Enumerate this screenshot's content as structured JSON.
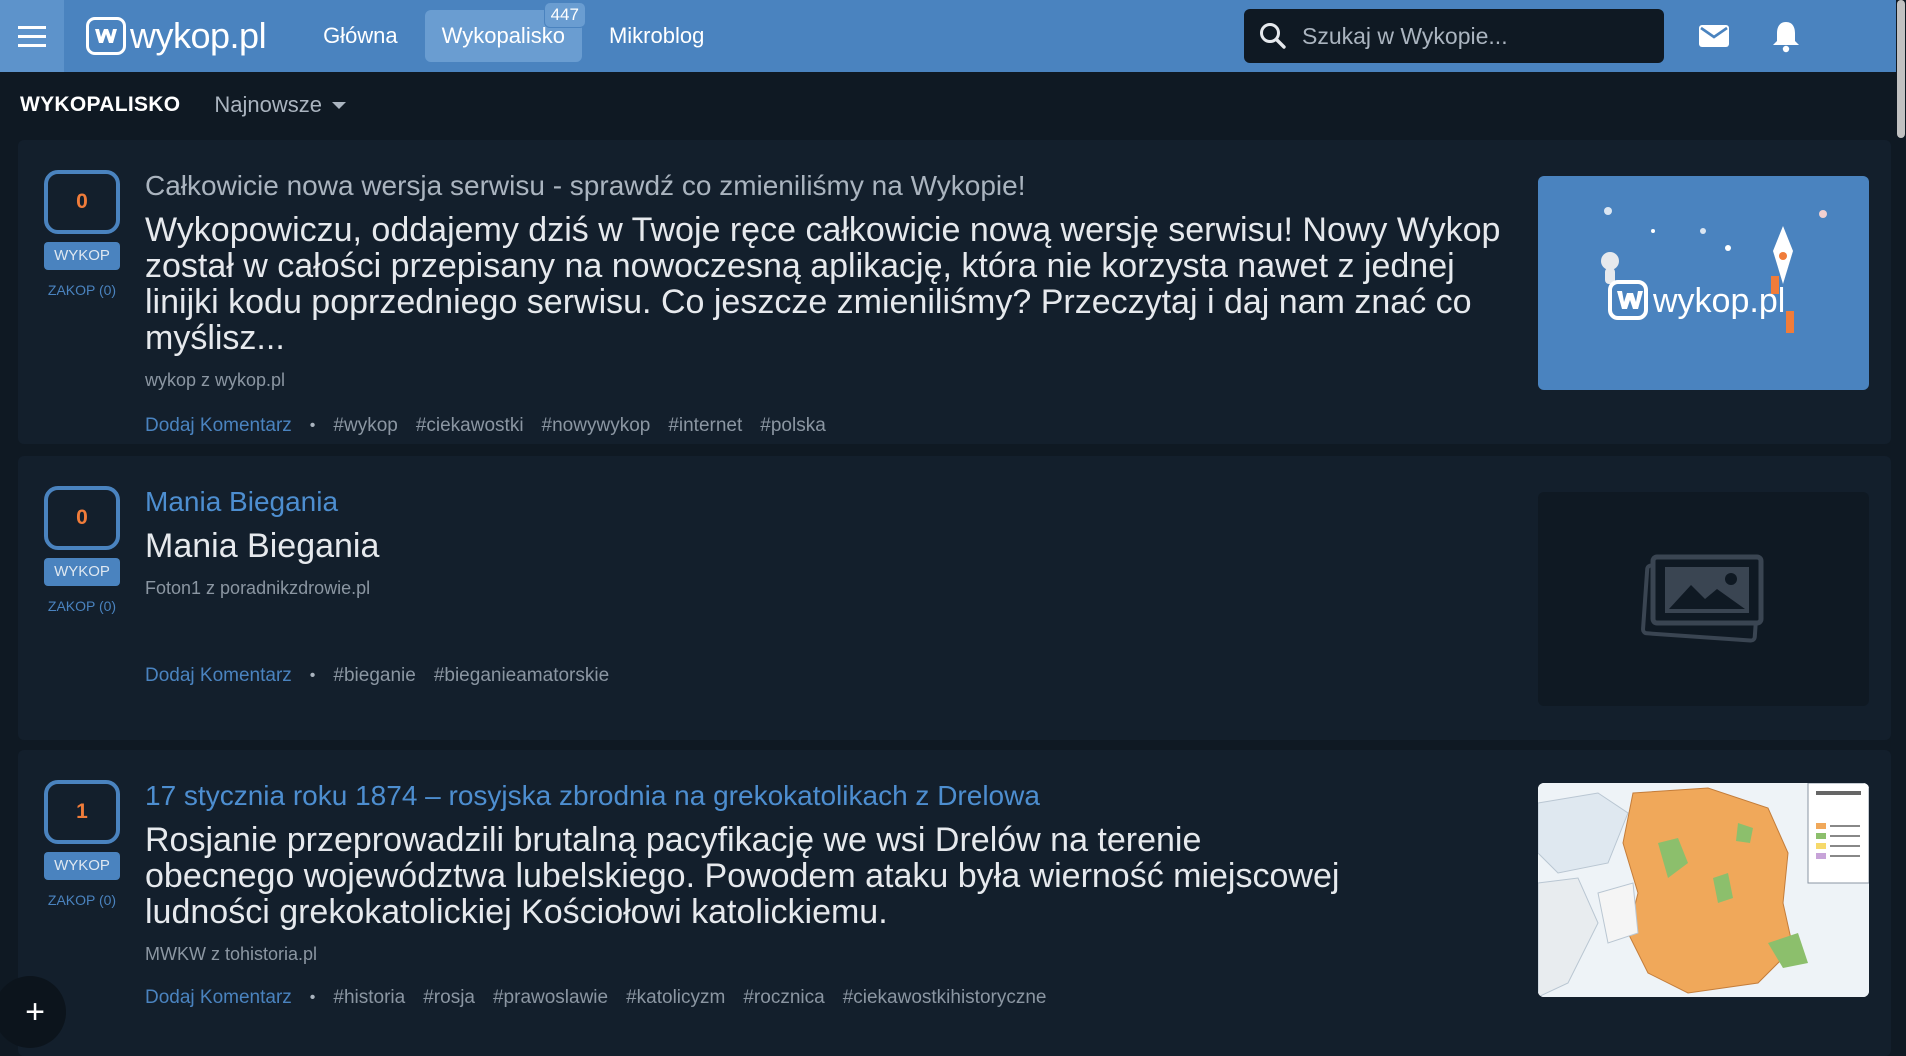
{
  "header": {
    "logo_text": "wykop.pl",
    "nav": [
      {
        "label": "Główna"
      },
      {
        "label": "Wykopalisko",
        "badge": "447"
      },
      {
        "label": "Mikroblog"
      }
    ],
    "search_placeholder": "Szukaj w Wykopie..."
  },
  "subheader": {
    "title": "WYKOPALISKO",
    "sort_label": "Najnowsze"
  },
  "labels": {
    "wykop": "WYKOP",
    "comment": "Dodaj Komentarz",
    "bullet": "•"
  },
  "links": [
    {
      "votes": "0",
      "zakop": "ZAKOP (0)",
      "title": "Całkowicie nowa wersja serwisu - sprawdź co zmieniliśmy na Wykopie!",
      "description": "Wykopowiczu, oddajemy dziś w Twoje ręce całkowicie nową wersję serwisu! Nowy Wykop został w całości przepisany na nowoczesną aplikację, która nie korzysta nawet z jednej linijki kodu poprzedniego serwisu. Co jeszcze zmieniliśmy? Przeczytaj i daj nam znać co myślisz...",
      "source": "wykop z wykop.pl",
      "tags": [
        "#wykop",
        "#ciekawostki",
        "#nowywykop",
        "#internet",
        "#polska"
      ],
      "thumb_text": "wykop.pl"
    },
    {
      "votes": "0",
      "zakop": "ZAKOP (0)",
      "title": "Mania Biegania",
      "description": "Mania Biegania",
      "source": "Foton1 z poradnikzdrowie.pl",
      "tags": [
        "#bieganie",
        "#bieganieamatorskie"
      ]
    },
    {
      "votes": "1",
      "zakop": "ZAKOP (0)",
      "title": "17 stycznia roku 1874 – rosyjska zbrodnia na grekokatolikach z Drelowa",
      "description": "Rosjanie przeprowadzili brutalną pacyfikację we wsi Drelów na terenie obecnego województwa lubelskiego. Powodem ataku była wierność miejscowej ludności grekokatolickiej Kościołowi katolickiemu.",
      "source": "MWKW z tohistoria.pl",
      "tags": [
        "#historia",
        "#rosja",
        "#prawoslawie",
        "#katolicyzm",
        "#rocznica",
        "#ciekawostkihistoryczne"
      ]
    }
  ],
  "fab_label": "+",
  "colors": {
    "topbar": "#4a83bf",
    "background": "#0f1923",
    "card": "#131f2c",
    "link_blue": "#4d8ed0",
    "vote_orange": "#f07c3a"
  },
  "icons": [
    "menu-icon",
    "search-icon",
    "mail-icon",
    "bell-icon",
    "image-placeholder-icon",
    "plus-icon"
  ]
}
